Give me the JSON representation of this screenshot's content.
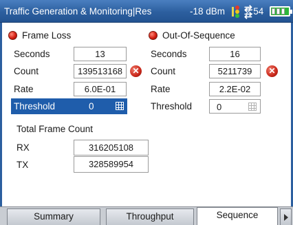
{
  "titlebar": {
    "title": "Traffic Generation  & Monitoring|Res",
    "power": "-18 dBm",
    "time": "2:54"
  },
  "frame_loss": {
    "label": "Frame Loss",
    "seconds_label": "Seconds",
    "seconds": "13",
    "count_label": "Count",
    "count": "139513168",
    "rate_label": "Rate",
    "rate": "6.0E-01",
    "threshold_label": "Threshold",
    "threshold": "0"
  },
  "out_of_sequence": {
    "label": "Out-Of-Sequence",
    "seconds_label": "Seconds",
    "seconds": "16",
    "count_label": "Count",
    "count": "5211739",
    "rate_label": "Rate",
    "rate": "2.2E-02",
    "threshold_label": "Threshold",
    "threshold": "0"
  },
  "total_frame_count": {
    "label": "Total Frame Count",
    "rx_label": "RX",
    "rx": "316205108",
    "tx_label": "TX",
    "tx": "328589954"
  },
  "tabs": [
    {
      "label": "Summary",
      "active": false
    },
    {
      "label": "Throughput",
      "active": false
    },
    {
      "label": "Sequence",
      "active": true
    }
  ],
  "icons": {
    "traffic": "traffic-light-icon",
    "arrows": "data-transfer-icon",
    "battery": "battery-icon",
    "clear": "clear-x-icon",
    "keypad": "keypad-icon",
    "led": "alarm-led-icon"
  },
  "colors": {
    "titlebar": "#2c5f9f",
    "selected_row": "#1f5dab",
    "led_red": "#d51f12",
    "battery_green": "#2db53a"
  }
}
